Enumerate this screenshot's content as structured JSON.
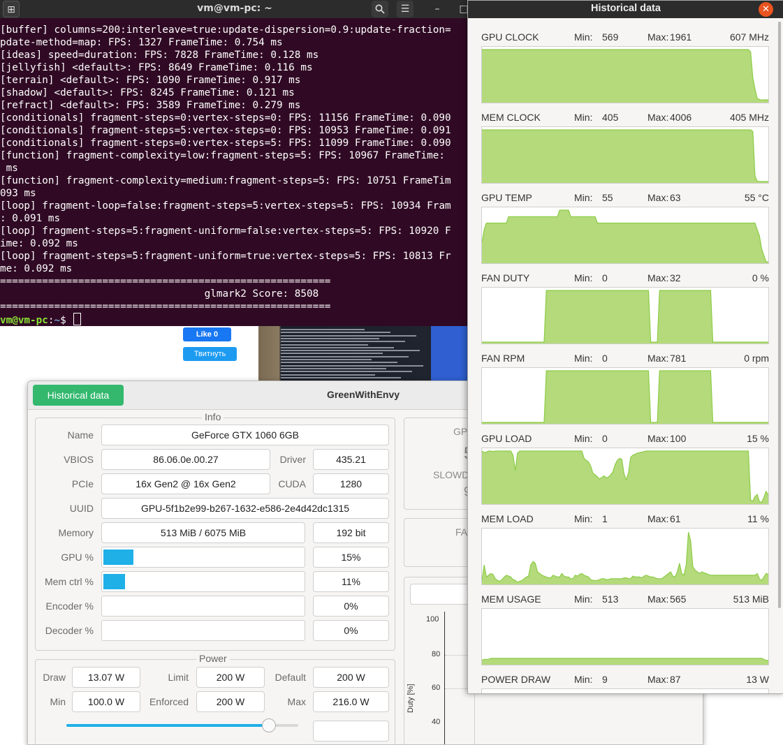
{
  "terminal": {
    "title": "vm@vm-pc: ~",
    "lines": [
      "[buffer] columns=200:interleave=true:update-dispersion=0.9:update-fraction=",
      "pdate-method=map: FPS: 1327 FrameTime: 0.754 ms",
      "[ideas] speed=duration: FPS: 7828 FrameTime: 0.128 ms",
      "[jellyfish] <default>: FPS: 8649 FrameTime: 0.116 ms",
      "[terrain] <default>: FPS: 1090 FrameTime: 0.917 ms",
      "[shadow] <default>: FPS: 8245 FrameTime: 0.121 ms",
      "[refract] <default>: FPS: 3589 FrameTime: 0.279 ms",
      "[conditionals] fragment-steps=0:vertex-steps=0: FPS: 11156 FrameTime: 0.090",
      "[conditionals] fragment-steps=5:vertex-steps=0: FPS: 10953 FrameTime: 0.091",
      "[conditionals] fragment-steps=0:vertex-steps=5: FPS: 11099 FrameTime: 0.090",
      "[function] fragment-complexity=low:fragment-steps=5: FPS: 10967 FrameTime: ",
      " ms",
      "[function] fragment-complexity=medium:fragment-steps=5: FPS: 10751 FrameTim",
      "093 ms",
      "[loop] fragment-loop=false:fragment-steps=5:vertex-steps=5: FPS: 10934 Fram",
      ": 0.091 ms",
      "[loop] fragment-steps=5:fragment-uniform=false:vertex-steps=5: FPS: 10920 F",
      "ime: 0.092 ms",
      "[loop] fragment-steps=5:fragment-uniform=true:vertex-steps=5: FPS: 10813 Fr",
      "me: 0.092 ms",
      "=======================================================",
      "                                  glmark2 Score: 8508",
      "======================================================="
    ],
    "prompt_user": "vm@vm-pc",
    "prompt_sep": ":",
    "prompt_path": "~",
    "prompt_end": "$ "
  },
  "web": {
    "like_label": "Like 0",
    "tweet_label": "Твитнуть"
  },
  "gwe": {
    "hist_button": "Historical data",
    "title": "GreenWithEnvy",
    "info": {
      "legend": "Info",
      "name_label": "Name",
      "name_value": "GeForce GTX 1060 6GB",
      "vbios_label": "VBIOS",
      "vbios_value": "86.06.0e.00.27",
      "driver_label": "Driver",
      "driver_value": "435.21",
      "pcie_label": "PCIe",
      "pcie_value": "16x Gen2 @ 16x Gen2",
      "cuda_label": "CUDA",
      "cuda_value": "1280",
      "uuid_label": "UUID",
      "uuid_value": "GPU-5f1b2e99-b267-1632-e586-2e4d42dc1315",
      "memory_label": "Memory",
      "memory_value": "513 MiB / 6075 MiB",
      "memory_bus": "192 bit",
      "gpu_label": "GPU %",
      "gpu_value": "15%",
      "gpu_fraction": 0.15,
      "memctrl_label": "Mem ctrl %",
      "memctrl_value": "11%",
      "memctrl_fraction": 0.11,
      "encoder_label": "Encoder %",
      "encoder_value": "0%",
      "decoder_label": "Decoder %",
      "decoder_value": "0%"
    },
    "power": {
      "legend": "Power",
      "draw_label": "Draw",
      "draw_value": "13.07 W",
      "limit_label": "Limit",
      "limit_value": "200 W",
      "default_label": "Default",
      "default_value": "200 W",
      "min_label": "Min",
      "min_value": "100.0 W",
      "enforced_label": "Enforced",
      "enforced_value": "200 W",
      "max_label": "Max",
      "max_value": "216.0 W",
      "slider_fraction": 0.87
    },
    "right": {
      "gpu_partial": "GPU",
      "slowd_partial": "SLOWD",
      "fan_partial": "FA",
      "big5": "5",
      "big9": "9",
      "ylabel": "Duty [%]",
      "yticks": [
        "100",
        "80",
        "60",
        "40"
      ]
    }
  },
  "historical": {
    "title": "Historical data",
    "min_label": "Min:",
    "max_label": "Max:",
    "fill_color": "#b4da7c",
    "line_color": "#8ccc45",
    "metrics": [
      {
        "name": "GPU CLOCK",
        "min": "569",
        "max": "1961",
        "current": "607 MHz",
        "series": [
          1961,
          1961,
          1961,
          1961,
          1961,
          1961,
          1961,
          1961,
          1961,
          1961,
          1961,
          1961,
          1961,
          1961,
          1961,
          1961,
          1961,
          1961,
          1961,
          1961,
          1961,
          1961,
          1961,
          1961,
          1961,
          1961,
          1961,
          1961,
          1961,
          1961,
          1961,
          1961,
          1961,
          1961,
          1961,
          1961,
          1961,
          1961,
          1961,
          1961,
          1961,
          1961,
          1961,
          1961,
          1961,
          1961,
          1961,
          1961,
          1961,
          1961,
          1961,
          1961,
          1961,
          1961,
          1961,
          1961,
          1961,
          1961,
          1961,
          1961,
          1961,
          1961,
          1961,
          1961,
          1961,
          1961,
          1961,
          1961,
          1961,
          1961,
          1961,
          1961,
          1961,
          1961,
          1961,
          1961,
          1961,
          1961,
          1961,
          1961,
          1961,
          1961,
          1961,
          1961,
          1961,
          1961,
          1961,
          1961,
          1961,
          1961,
          1961,
          1961,
          1961,
          1961,
          1961,
          1961,
          1961,
          1961,
          1961,
          1961,
          1961,
          1961,
          1961,
          1961,
          1961,
          1961,
          1961,
          1961,
          1961,
          1961,
          1961,
          1961,
          1961,
          1961,
          1961,
          1961,
          1961,
          1961,
          1961,
          1961,
          1961,
          1900,
          1200,
          900,
          640,
          620,
          600,
          607,
          607,
          607
        ]
      },
      {
        "name": "MEM CLOCK",
        "min": "405",
        "max": "4006",
        "current": "405 MHz",
        "series": [
          4006,
          4006,
          4006,
          4006,
          4006,
          4006,
          4006,
          4006,
          4006,
          4006,
          4006,
          4006,
          4006,
          4006,
          4006,
          4006,
          4006,
          4006,
          4006,
          4006,
          4006,
          4006,
          4006,
          4006,
          4006,
          4006,
          4006,
          4006,
          4006,
          4006,
          4006,
          4006,
          4006,
          4006,
          4006,
          4006,
          4006,
          4006,
          4006,
          4006,
          4006,
          4006,
          4006,
          4006,
          4006,
          4006,
          4006,
          4006,
          4006,
          4006,
          4006,
          4006,
          4006,
          4006,
          4006,
          4006,
          4006,
          4006,
          4006,
          4006,
          4006,
          4006,
          4006,
          4006,
          4006,
          4006,
          4006,
          4006,
          4006,
          4006,
          4006,
          4006,
          4006,
          4006,
          4006,
          4006,
          4006,
          4006,
          4006,
          4006,
          4006,
          4006,
          4006,
          4006,
          4006,
          4006,
          4006,
          4006,
          4006,
          4006,
          4006,
          4006,
          4006,
          4006,
          4006,
          4006,
          4006,
          4006,
          4006,
          4006,
          4006,
          4006,
          4006,
          4006,
          4006,
          4006,
          4006,
          4006,
          4006,
          4006,
          4006,
          4006,
          4006,
          4006,
          4006,
          4006,
          4006,
          4006,
          4006,
          4006,
          4006,
          4006,
          3900,
          800,
          430,
          405,
          405,
          405,
          405,
          405
        ]
      },
      {
        "name": "GPU TEMP",
        "min": "55",
        "max": "63",
        "current": "55 °C",
        "series": [
          58,
          60,
          61,
          61,
          61,
          61,
          61,
          61,
          61,
          61,
          61,
          61,
          62,
          62,
          62,
          62,
          62,
          62,
          62,
          62,
          62,
          62,
          62,
          62,
          62,
          62,
          62,
          62,
          62,
          62,
          62,
          62,
          62,
          62,
          62,
          63,
          63,
          63,
          63,
          63,
          62,
          62,
          62,
          62,
          62,
          62,
          62,
          62,
          62,
          62,
          62,
          62,
          61,
          61,
          61,
          61,
          61,
          61,
          61,
          61,
          61,
          61,
          61,
          61,
          61,
          61,
          61,
          61,
          61,
          61,
          61,
          61,
          61,
          61,
          61,
          61,
          61,
          61,
          61,
          61,
          61,
          61,
          61,
          61,
          61,
          61,
          61,
          61,
          61,
          61,
          61,
          61,
          61,
          61,
          61,
          61,
          61,
          61,
          61,
          61,
          61,
          61,
          61,
          61,
          61,
          61,
          61,
          61,
          61,
          61,
          61,
          61,
          61,
          61,
          61,
          61,
          61,
          61,
          61,
          61,
          61,
          61,
          61,
          61,
          60,
          59,
          57,
          56,
          55,
          55
        ]
      },
      {
        "name": "FAN DUTY",
        "min": "0",
        "max": "32",
        "current": "0 %",
        "series": [
          0,
          0,
          0,
          0,
          0,
          0,
          0,
          0,
          0,
          0,
          0,
          0,
          0,
          0,
          0,
          0,
          0,
          0,
          0,
          0,
          0,
          0,
          0,
          0,
          0,
          0,
          0,
          0,
          0,
          32,
          32,
          32,
          32,
          32,
          32,
          32,
          32,
          32,
          32,
          32,
          32,
          32,
          32,
          32,
          32,
          32,
          32,
          32,
          32,
          32,
          32,
          32,
          32,
          32,
          32,
          32,
          32,
          32,
          32,
          32,
          32,
          32,
          32,
          32,
          32,
          32,
          32,
          32,
          32,
          32,
          32,
          32,
          32,
          32,
          32,
          32,
          0,
          0,
          0,
          0,
          32,
          32,
          32,
          32,
          32,
          32,
          32,
          32,
          32,
          32,
          32,
          32,
          32,
          32,
          32,
          32,
          32,
          32,
          32,
          32,
          32,
          32,
          32,
          32,
          0,
          0,
          0,
          0,
          0,
          0,
          0,
          0,
          0,
          0,
          0,
          0,
          0,
          0,
          0,
          0,
          0,
          0,
          0,
          0,
          0,
          0,
          0,
          0,
          0,
          0
        ]
      },
      {
        "name": "FAN RPM",
        "min": "0",
        "max": "781",
        "current": "0 rpm",
        "series": [
          0,
          0,
          0,
          0,
          0,
          0,
          0,
          0,
          0,
          0,
          0,
          0,
          0,
          0,
          0,
          0,
          0,
          0,
          0,
          0,
          0,
          0,
          0,
          0,
          0,
          0,
          0,
          0,
          0,
          781,
          781,
          781,
          781,
          781,
          781,
          781,
          781,
          781,
          781,
          781,
          781,
          781,
          781,
          781,
          781,
          781,
          781,
          781,
          781,
          781,
          781,
          781,
          781,
          781,
          781,
          781,
          781,
          781,
          781,
          781,
          781,
          781,
          781,
          781,
          781,
          781,
          781,
          781,
          781,
          781,
          781,
          781,
          781,
          781,
          781,
          781,
          0,
          0,
          0,
          0,
          781,
          781,
          781,
          781,
          781,
          781,
          781,
          781,
          781,
          781,
          781,
          781,
          781,
          781,
          781,
          781,
          781,
          781,
          781,
          781,
          781,
          781,
          781,
          781,
          0,
          0,
          0,
          0,
          0,
          0,
          0,
          0,
          0,
          0,
          0,
          0,
          0,
          0,
          0,
          0,
          0,
          0,
          0,
          0,
          0,
          0,
          0,
          0,
          0,
          0
        ]
      },
      {
        "name": "GPU LOAD",
        "min": "0",
        "max": "100",
        "current": "15 %",
        "series": [
          100,
          97,
          98,
          100,
          100,
          99,
          100,
          100,
          100,
          100,
          100,
          100,
          100,
          100,
          92,
          62,
          96,
          100,
          100,
          100,
          100,
          100,
          100,
          100,
          100,
          100,
          100,
          100,
          100,
          100,
          100,
          100,
          100,
          100,
          100,
          100,
          100,
          100,
          100,
          100,
          100,
          100,
          100,
          100,
          100,
          100,
          86,
          82,
          79,
          71,
          57,
          54,
          50,
          46,
          49,
          52,
          48,
          50,
          54,
          60,
          74,
          82,
          86,
          84,
          56,
          44,
          58,
          88,
          92,
          94,
          96,
          97,
          98,
          99,
          100,
          100,
          100,
          100,
          100,
          100,
          100,
          100,
          100,
          100,
          100,
          100,
          100,
          100,
          100,
          100,
          100,
          100,
          100,
          100,
          100,
          100,
          100,
          100,
          100,
          100,
          100,
          100,
          100,
          100,
          100,
          100,
          100,
          100,
          100,
          100,
          100,
          100,
          100,
          100,
          100,
          100,
          100,
          100,
          100,
          100,
          100,
          5,
          3,
          12,
          16,
          2,
          1,
          10,
          22,
          15
        ]
      },
      {
        "name": "MEM LOAD",
        "min": "1",
        "max": "61",
        "current": "11 %",
        "series": [
          4,
          22,
          8,
          10,
          12,
          11,
          6,
          4,
          3,
          5,
          8,
          10,
          9,
          8,
          5,
          4,
          2,
          3,
          4,
          6,
          8,
          9,
          22,
          26,
          24,
          14,
          12,
          10,
          9,
          8,
          7,
          7,
          10,
          9,
          8,
          8,
          12,
          9,
          8,
          8,
          6,
          6,
          10,
          9,
          11,
          12,
          10,
          9,
          8,
          5,
          4,
          4,
          4,
          5,
          6,
          6,
          5,
          5,
          6,
          6,
          6,
          6,
          6,
          6,
          7,
          7,
          6,
          6,
          9,
          8,
          8,
          8,
          7,
          9,
          10,
          9,
          8,
          8,
          7,
          6,
          6,
          6,
          8,
          10,
          12,
          14,
          9,
          8,
          14,
          24,
          12,
          10,
          22,
          60,
          50,
          20,
          16,
          14,
          12,
          14,
          13,
          12,
          11,
          10,
          10,
          10,
          10,
          10,
          10,
          10,
          10,
          10,
          10,
          10,
          10,
          10,
          10,
          10,
          10,
          10,
          10,
          10,
          10,
          10,
          12,
          6,
          4,
          8,
          12,
          11
        ]
      },
      {
        "name": "MEM USAGE",
        "min": "513",
        "max": "565",
        "current": "513 MiB",
        "series": [
          516,
          517,
          517,
          517,
          518,
          518,
          518,
          518,
          518,
          518,
          518,
          518,
          518,
          518,
          518,
          518,
          518,
          518,
          518,
          518,
          518,
          518,
          518,
          518,
          518,
          518,
          518,
          518,
          518,
          518,
          518,
          518,
          518,
          518,
          518,
          518,
          518,
          518,
          518,
          518,
          518,
          518,
          518,
          518,
          518,
          518,
          518,
          518,
          518,
          518,
          518,
          518,
          518,
          518,
          518,
          518,
          518,
          518,
          518,
          518,
          518,
          518,
          518,
          518,
          518,
          518,
          518,
          518,
          518,
          518,
          518,
          518,
          518,
          518,
          518,
          518,
          518,
          518,
          518,
          518,
          518,
          518,
          518,
          518,
          518,
          518,
          518,
          518,
          518,
          518,
          518,
          518,
          518,
          518,
          518,
          518,
          518,
          518,
          518,
          518,
          518,
          518,
          518,
          518,
          518,
          518,
          518,
          518,
          518,
          518,
          518,
          518,
          518,
          518,
          518,
          518,
          518,
          518,
          518,
          518,
          518,
          518,
          518,
          518,
          518,
          518,
          518,
          517,
          516,
          516
        ]
      },
      {
        "name": "POWER DRAW",
        "min": "9",
        "max": "87",
        "current": "13 W",
        "series": []
      }
    ]
  }
}
